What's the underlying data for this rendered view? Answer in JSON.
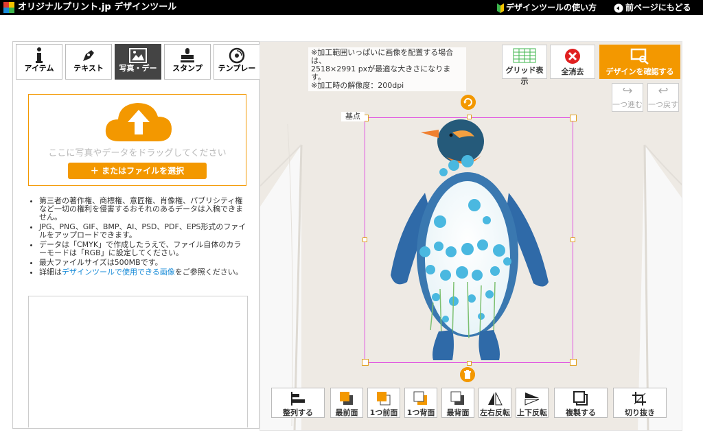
{
  "header": {
    "brand": "オリジナルプリント.jp デザインツール",
    "help_link": "デザインツールの使い方",
    "back_link": "前ページにもどる"
  },
  "tabs": [
    {
      "label": "アイテム",
      "icon": "info-icon"
    },
    {
      "label": "テキスト",
      "icon": "pen-icon"
    },
    {
      "label": "写真・デー",
      "icon": "image-icon"
    },
    {
      "label": "スタンプ",
      "icon": "stamp-icon"
    },
    {
      "label": "テンプレー",
      "icon": "template-icon"
    }
  ],
  "upload": {
    "drop_text": "ここに写真やデータをドラッグしてください",
    "file_button": "＋ またはファイルを選択"
  },
  "notes": {
    "n1": "第三者の著作権、商標権、意匠権、肖像権、パブリシティ権など一切の権利を侵害するおそれのあるデータは入稿できません。",
    "n2": "JPG、PNG、GIF、BMP、AI、PSD、PDF、EPS形式のファイルをアップロードできます。",
    "n3": "データは「CMYK」で作成したうえで、ファイル自体のカラーモードは「RGB」に設定してください。",
    "n4": "最大ファイルサイズは500MBです。",
    "n5_pre": "詳細は",
    "n5_link": "デザインツールで使用できる画像",
    "n5_post": "をご参照ください。"
  },
  "canvas": {
    "info_line1": "※加工範囲いっぱいに画像を配置する場合は、",
    "info_line2": "2518×2991 pxが最適な大きさになります。",
    "info_line3": "※加工時の解像度：200dpi",
    "anchor_label": "基点"
  },
  "top_buttons": {
    "grid": "グリッド表示",
    "clear": "全消去",
    "confirm": "デザインを確認する",
    "redo": "一つ進む",
    "undo": "一つ戻す"
  },
  "toolbar": {
    "align": "整列する",
    "front": "最前面",
    "forward": "1つ前面",
    "backward": "1つ背面",
    "back": "最背面",
    "flip_h": "左右反転",
    "flip_v": "上下反転",
    "duplicate": "複製する",
    "crop": "切り抜き"
  },
  "colors": {
    "accent": "#f39800",
    "selection": "#e04ee0",
    "link": "#1a8cd8"
  }
}
